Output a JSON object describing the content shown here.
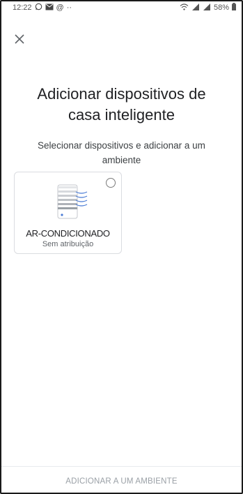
{
  "status_bar": {
    "time": "12:22",
    "left_icons": [
      "whatsapp-icon",
      "mail-icon",
      "at-icon",
      "more-dots-icon"
    ],
    "right_icons": [
      "wifi-icon",
      "signal-icon",
      "signal-icon",
      "battery-icon"
    ],
    "battery": "58%"
  },
  "header": {
    "close_icon": "close-icon"
  },
  "main": {
    "title": "Adicionar dispositivos de casa inteligente",
    "subtitle": "Selecionar dispositivos e adicionar a um ambiente",
    "devices": [
      {
        "name": "AR-CONDICIONADO",
        "status": "Sem atribuição",
        "icon": "air-conditioner-icon",
        "selected": false
      }
    ]
  },
  "footer": {
    "action_label": "ADICIONAR A UM AMBIENTE"
  }
}
